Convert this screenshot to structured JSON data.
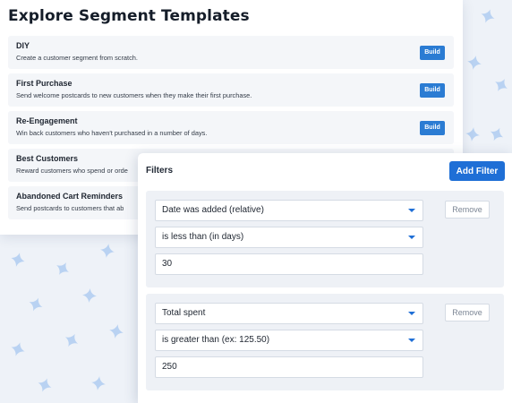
{
  "colors": {
    "background": "#eef2f8",
    "star": "#b9d2f2",
    "accent_blue": "#1f6fd6",
    "build_blue": "#2b7cd3"
  },
  "templates": {
    "title": "Explore Segment Templates",
    "items": [
      {
        "name": "DIY",
        "description": "Create a customer segment from scratch.",
        "button": "Build"
      },
      {
        "name": "First Purchase",
        "description": "Send welcome postcards to new customers when they make their first purchase.",
        "button": "Build"
      },
      {
        "name": "Re-Engagement",
        "description": "Win back customers who haven't purchased in a number of days.",
        "button": "Build"
      },
      {
        "name": "Best Customers",
        "description": "Reward customers who spend or orde"
      },
      {
        "name": "Abandoned Cart Reminders",
        "description": "Send postcards to customers that ab"
      }
    ]
  },
  "filters": {
    "title": "Filters",
    "add_button": "Add Filter",
    "groups": [
      {
        "field": "Date was added (relative)",
        "operator": "is less than (in days)",
        "value": "30",
        "remove": "Remove"
      },
      {
        "field": "Total spent",
        "operator": "is greater than (ex: 125.50)",
        "value": "250",
        "remove": "Remove"
      }
    ]
  }
}
